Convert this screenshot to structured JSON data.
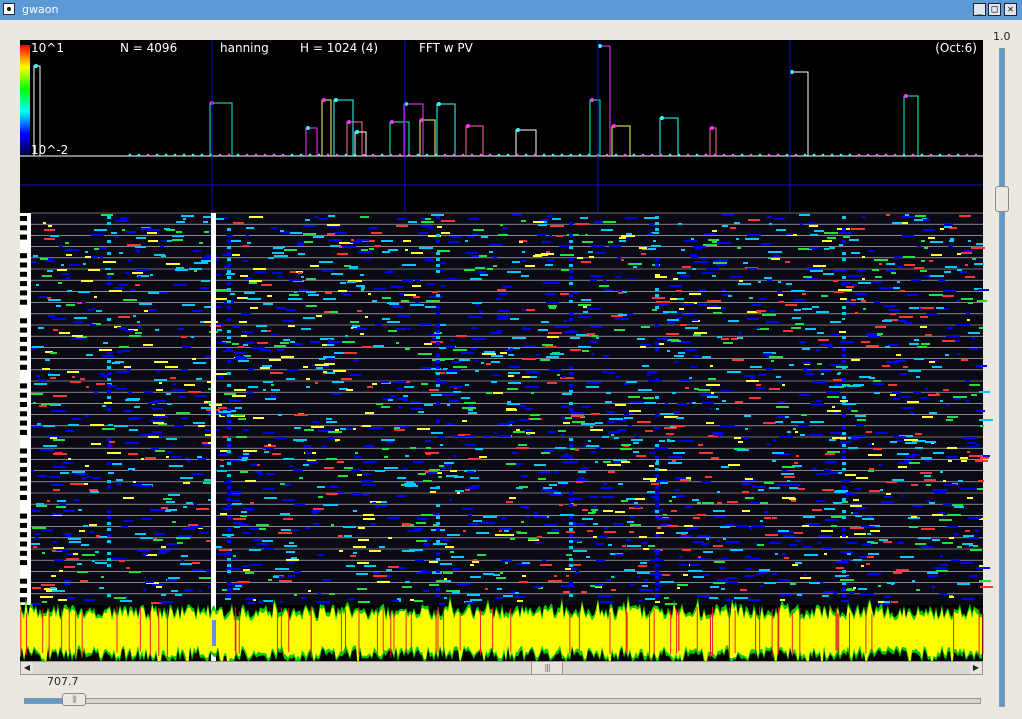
{
  "window": {
    "title": "gwaon",
    "buttons": {
      "minimize": "_",
      "maximize": "□",
      "close": "✕"
    }
  },
  "view": {
    "scale_top": "10^1",
    "scale_bottom": "10^-2",
    "n": "N = 4096",
    "window_fn": "hanning",
    "hop": "H = 1024 (4)",
    "method": "FFT w PV",
    "octave": "(Oct:6)"
  },
  "zoom_slider": {
    "value_label": "707.7",
    "value_fraction": 0.04
  },
  "gain_slider": {
    "value_label": "1.0",
    "value_fraction": 0.77
  },
  "hscroll": {
    "position_fraction": 0.53,
    "left_arrow": "◀",
    "right_arrow": "▶",
    "grip": "|||"
  },
  "colors": {
    "background": "#000000",
    "accent": "#5b9bd5",
    "cursor": "#1010c0",
    "waveform_yellow": "#ffff00",
    "waveform_green": "#00cc00",
    "waveform_red": "#dd2222",
    "piano_roll_blue": "#0000ff",
    "piano_roll_cyan": "#00c8ff",
    "piano_roll_green": "#20e040"
  }
}
